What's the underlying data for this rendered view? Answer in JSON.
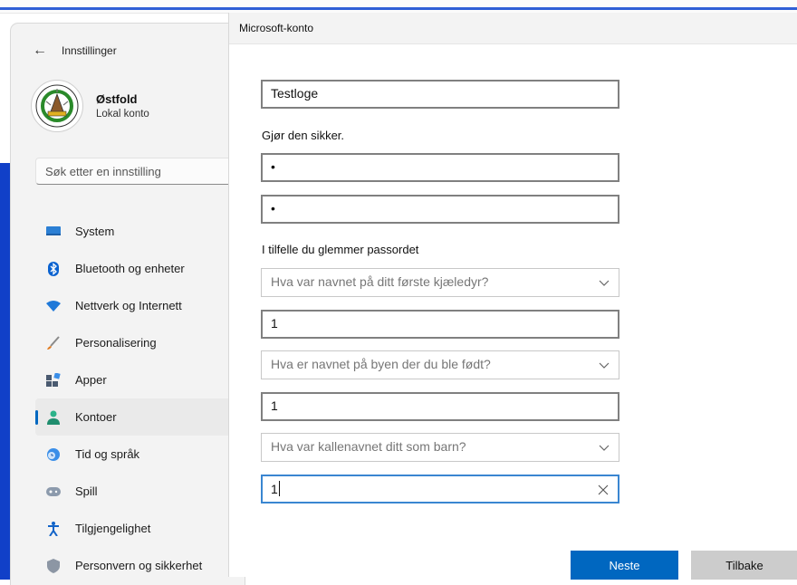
{
  "settings": {
    "back_title": "Innstillinger",
    "profile": {
      "name": "Østfold",
      "subtitle": "Lokal konto"
    },
    "search": {
      "placeholder": "Søk etter en innstilling"
    },
    "nav": [
      {
        "label": "System",
        "icon": "monitor-icon"
      },
      {
        "label": "Bluetooth og enheter",
        "icon": "bluetooth-icon"
      },
      {
        "label": "Nettverk og Internett",
        "icon": "wifi-icon"
      },
      {
        "label": "Personalisering",
        "icon": "brush-icon"
      },
      {
        "label": "Apper",
        "icon": "apps-icon"
      },
      {
        "label": "Kontoer",
        "icon": "person-icon",
        "active": true
      },
      {
        "label": "Tid og språk",
        "icon": "globe-clock-icon"
      },
      {
        "label": "Spill",
        "icon": "gamepad-icon"
      },
      {
        "label": "Tilgjengelighet",
        "icon": "accessibility-icon"
      },
      {
        "label": "Personvern og sikkerhet",
        "icon": "shield-icon"
      }
    ]
  },
  "dialog": {
    "title": "Microsoft-konto",
    "username": "Testloge",
    "secure_label": "Gjør den sikker.",
    "password": "•",
    "password_confirm": "•",
    "recovery_label": "I tilfelle du glemmer passordet",
    "questions": [
      {
        "question": "Hva var navnet på ditt første kjæledyr?",
        "answer": "1"
      },
      {
        "question": "Hva er navnet på byen der du ble født?",
        "answer": "1"
      },
      {
        "question": "Hva var kallenavnet ditt som barn?",
        "answer": "1"
      }
    ],
    "next_label": "Neste",
    "back_label": "Tilbake"
  },
  "colors": {
    "accent": "#0067c0",
    "focus": "#3a86d1",
    "desktop": "#1140c8"
  }
}
